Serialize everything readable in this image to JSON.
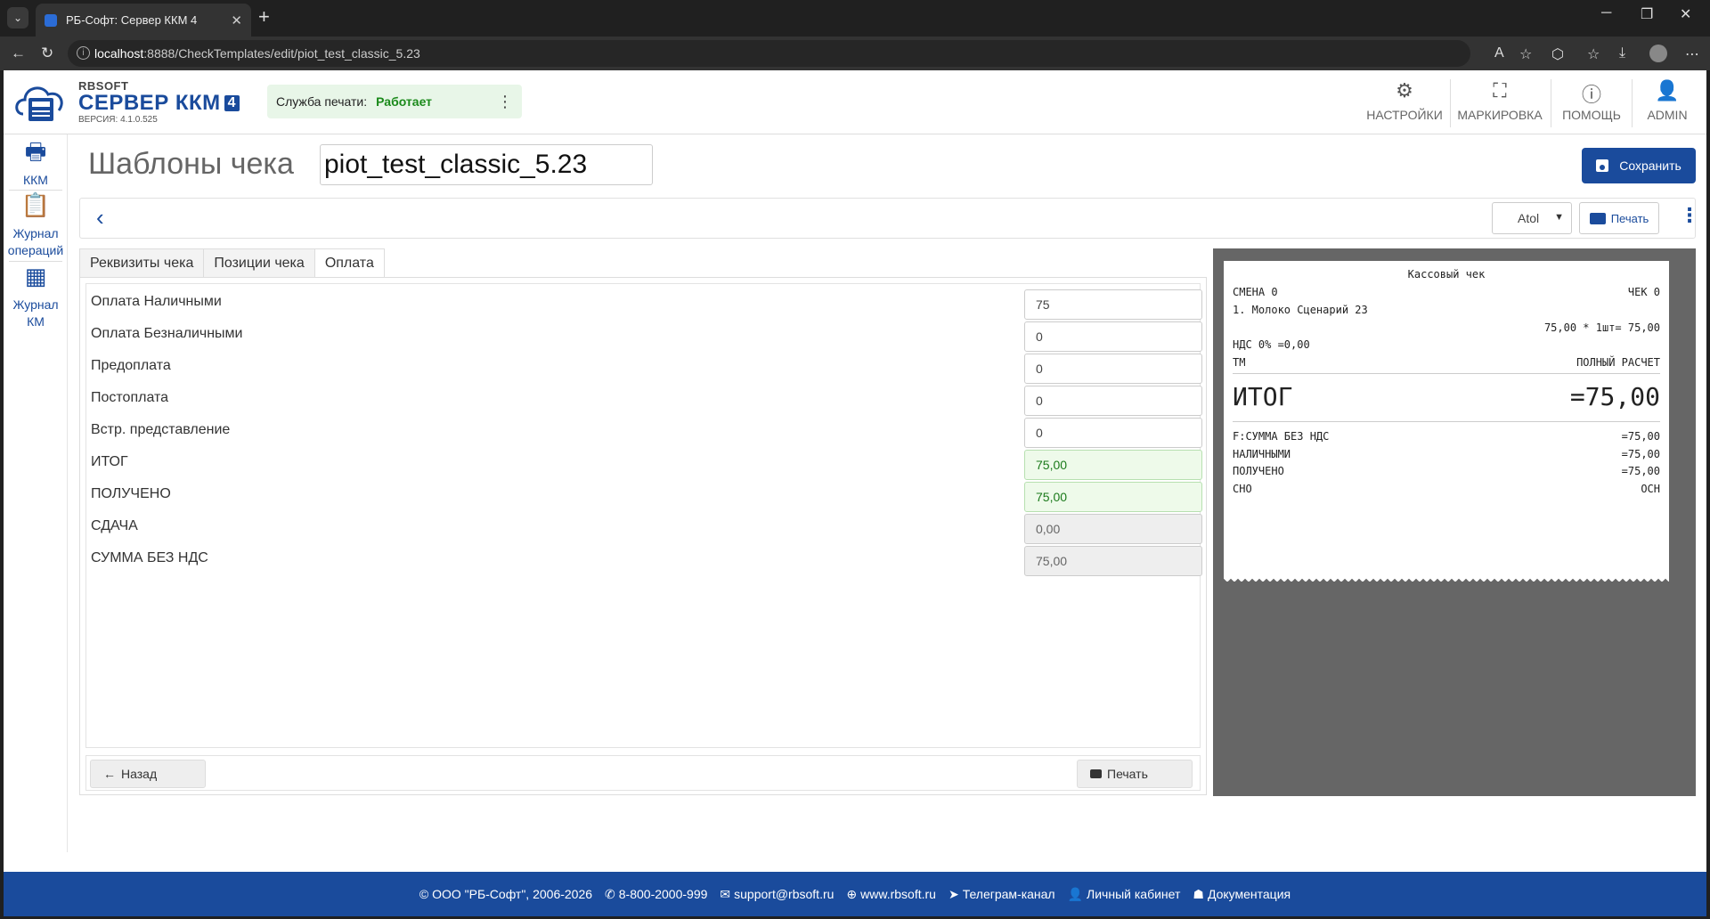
{
  "browser": {
    "tab_title": "РБ-Софт: Сервер ККМ 4",
    "url_host": "localhost",
    "url_rest": ":8888/CheckTemplates/edit/piot_test_classic_5.23"
  },
  "header": {
    "brand": "RBSOFT",
    "title": "СЕРВЕР ККМ",
    "title_badge": "4",
    "version": "ВЕРСИЯ: 4.1.0.525",
    "print_service_label": "Служба печати:",
    "print_service_status": "Работает",
    "buttons": {
      "settings": "НАСТРОЙКИ",
      "marking": "МАРКИРОВКА",
      "help": "ПОМОЩЬ",
      "admin": "ADMIN"
    }
  },
  "sidebar": {
    "kkm": "ККМ",
    "journal_ops_1": "Журнал",
    "journal_ops_2": "операций",
    "journal_km_1": "Журнал",
    "journal_km_2": "КМ"
  },
  "page": {
    "title": "Шаблоны чека",
    "template_name": "piot_test_classic_5.23",
    "save_label": "Сохранить",
    "driver": "Atol",
    "print_label": "Печать"
  },
  "tabs": [
    "Реквизиты чека",
    "Позиции чека",
    "Оплата"
  ],
  "form": {
    "rows": [
      {
        "label": "Оплата Наличными",
        "value": "75"
      },
      {
        "label": "Оплата Безналичными",
        "value": "0"
      },
      {
        "label": "Предоплата",
        "value": "0"
      },
      {
        "label": "Постоплата",
        "value": "0"
      },
      {
        "label": "Встр. представление",
        "value": "0"
      },
      {
        "label": "ИТОГ",
        "value": "75,00"
      },
      {
        "label": "ПОЛУЧЕНО",
        "value": "75,00"
      },
      {
        "label": "СДАЧА",
        "value": "0,00"
      },
      {
        "label": "СУММА БЕЗ НДС",
        "value": "75,00"
      }
    ],
    "back_label": "Назад",
    "print_label": "Печать"
  },
  "receipt": {
    "title": "Кассовый чек",
    "shift": "СМЕНА 0",
    "check_no": "ЧЕК 0",
    "item": "1. Молоко Сценарий 23",
    "item_calc": "75,00 * 1шт= 75,00",
    "vat": "НДС 0% =0,00",
    "tm": "ТМ",
    "calc_mode": "ПОЛНЫЙ РАСЧЕТ",
    "total_label": "ИТОГ",
    "total_value": "=75,00",
    "no_vat_label": "F:СУММА БЕЗ НДС",
    "no_vat_value": "=75,00",
    "cash_label": "НАЛИЧНЫМИ",
    "cash_value": "=75,00",
    "received_label": "ПОЛУЧЕНО",
    "received_value": "=75,00",
    "sno_label": "СНО",
    "sno_value": "ОСН"
  },
  "footer": {
    "copyright": "© ООО \"РБ-Софт\", 2006-2026",
    "phone": "8-800-2000-999",
    "email": "support@rbsoft.ru",
    "site": "www.rbsoft.ru",
    "telegram": "Телеграм-канал",
    "cabinet": "Личный кабинет",
    "docs": "Документация"
  }
}
